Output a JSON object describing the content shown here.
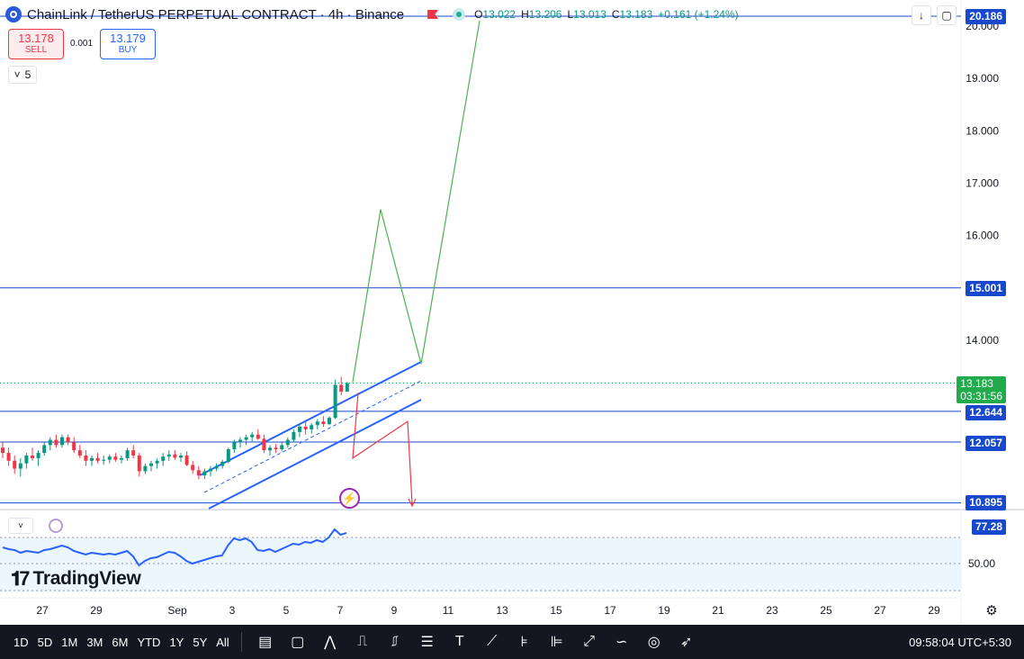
{
  "header": {
    "symbol": "ChainLink / TetherUS PERPETUAL CONTRACT · 4h · Binance",
    "ohlc": [
      {
        "k": "O",
        "v": "13.022"
      },
      {
        "k": "H",
        "v": "13.206"
      },
      {
        "k": "L",
        "v": "13.013"
      },
      {
        "k": "C",
        "v": "13.183"
      },
      {
        "k": "",
        "v": "+0.161 (+1.24%)"
      }
    ]
  },
  "trade": {
    "sell_price": "13.178",
    "sell_label": "SELL",
    "spread": "0.001",
    "buy_price": "13.179",
    "buy_label": "BUY"
  },
  "legend_toggle_count": "5",
  "price_labels": {
    "top": "20.186",
    "line1": "15.001",
    "current": "13.183",
    "countdown": "03:31:56",
    "line2": "12.644",
    "line3": "12.057",
    "line4": "10.895"
  },
  "price_axis_ticks": [
    "20.000",
    "19.000",
    "18.000",
    "17.000",
    "16.000",
    "14.000"
  ],
  "indicator": {
    "value_label": "77.28",
    "tick_label": "50.00"
  },
  "time_axis_ticks": [
    "27",
    "29",
    "Sep",
    "3",
    "5",
    "7",
    "9",
    "11",
    "13",
    "15",
    "17",
    "19",
    "21",
    "23",
    "25",
    "27",
    "29"
  ],
  "brand": "TradingView",
  "bottom_bar": {
    "timeframes": [
      "1D",
      "5D",
      "1M",
      "3M",
      "6M",
      "YTD",
      "1Y",
      "5Y",
      "All"
    ],
    "clock": "09:58:04 UTC+5:30",
    "tool_icons": [
      "calendar-range-icon",
      "rectangle-icon",
      "path-icon",
      "long-position-icon",
      "short-position-icon",
      "parallel-channel-icon",
      "text-icon",
      "trend-line-icon",
      "fib-retracement-icon",
      "volume-profile-icon",
      "measure-icon",
      "curve-icon",
      "circle-target-icon",
      "arrow-icon"
    ]
  },
  "colors": {
    "level_line": "#1848cc",
    "channel": "#2962ff",
    "bull_path": "#4caf50",
    "bear_path": "#f23645",
    "candle_up": "#089981",
    "candle_down": "#f23645",
    "indicator_line": "#2962ff"
  },
  "chart_data": {
    "type": "candlestick",
    "candles": [
      {
        "o": 11.95,
        "h": 12.05,
        "l": 11.75,
        "c": 11.85
      },
      {
        "o": 11.85,
        "h": 11.95,
        "l": 11.6,
        "c": 11.7
      },
      {
        "o": 11.7,
        "h": 11.8,
        "l": 11.45,
        "c": 11.55
      },
      {
        "o": 11.55,
        "h": 11.75,
        "l": 11.4,
        "c": 11.65
      },
      {
        "o": 11.65,
        "h": 11.85,
        "l": 11.55,
        "c": 11.8
      },
      {
        "o": 11.8,
        "h": 11.95,
        "l": 11.7,
        "c": 11.75
      },
      {
        "o": 11.75,
        "h": 11.9,
        "l": 11.6,
        "c": 11.85
      },
      {
        "o": 11.85,
        "h": 12.05,
        "l": 11.8,
        "c": 12.0
      },
      {
        "o": 12.0,
        "h": 12.15,
        "l": 11.9,
        "c": 12.1
      },
      {
        "o": 12.1,
        "h": 12.2,
        "l": 11.95,
        "c": 12.0
      },
      {
        "o": 12.0,
        "h": 12.2,
        "l": 11.95,
        "c": 12.15
      },
      {
        "o": 12.15,
        "h": 12.2,
        "l": 12.0,
        "c": 12.05
      },
      {
        "o": 12.05,
        "h": 12.15,
        "l": 11.85,
        "c": 11.9
      },
      {
        "o": 11.9,
        "h": 12.0,
        "l": 11.75,
        "c": 11.8
      },
      {
        "o": 11.8,
        "h": 11.9,
        "l": 11.6,
        "c": 11.7
      },
      {
        "o": 11.7,
        "h": 11.8,
        "l": 11.6,
        "c": 11.75
      },
      {
        "o": 11.75,
        "h": 11.85,
        "l": 11.65,
        "c": 11.7
      },
      {
        "o": 11.7,
        "h": 11.8,
        "l": 11.62,
        "c": 11.72
      },
      {
        "o": 11.72,
        "h": 11.82,
        "l": 11.65,
        "c": 11.78
      },
      {
        "o": 11.78,
        "h": 11.85,
        "l": 11.68,
        "c": 11.72
      },
      {
        "o": 11.72,
        "h": 11.8,
        "l": 11.65,
        "c": 11.75
      },
      {
        "o": 11.75,
        "h": 11.95,
        "l": 11.7,
        "c": 11.9
      },
      {
        "o": 11.9,
        "h": 12.0,
        "l": 11.75,
        "c": 11.8
      },
      {
        "o": 11.8,
        "h": 11.85,
        "l": 11.4,
        "c": 11.5
      },
      {
        "o": 11.5,
        "h": 11.65,
        "l": 11.45,
        "c": 11.6
      },
      {
        "o": 11.6,
        "h": 11.7,
        "l": 11.5,
        "c": 11.65
      },
      {
        "o": 11.65,
        "h": 11.75,
        "l": 11.55,
        "c": 11.7
      },
      {
        "o": 11.7,
        "h": 11.85,
        "l": 11.6,
        "c": 11.78
      },
      {
        "o": 11.78,
        "h": 11.9,
        "l": 11.7,
        "c": 11.82
      },
      {
        "o": 11.82,
        "h": 11.9,
        "l": 11.72,
        "c": 11.76
      },
      {
        "o": 11.76,
        "h": 11.85,
        "l": 11.68,
        "c": 11.8
      },
      {
        "o": 11.8,
        "h": 11.88,
        "l": 11.6,
        "c": 11.62
      },
      {
        "o": 11.62,
        "h": 11.7,
        "l": 11.45,
        "c": 11.52
      },
      {
        "o": 11.52,
        "h": 11.6,
        "l": 11.35,
        "c": 11.42
      },
      {
        "o": 11.42,
        "h": 11.55,
        "l": 11.35,
        "c": 11.5
      },
      {
        "o": 11.5,
        "h": 11.6,
        "l": 11.4,
        "c": 11.55
      },
      {
        "o": 11.55,
        "h": 11.65,
        "l": 11.5,
        "c": 11.6
      },
      {
        "o": 11.6,
        "h": 11.72,
        "l": 11.55,
        "c": 11.68
      },
      {
        "o": 11.68,
        "h": 11.95,
        "l": 11.65,
        "c": 11.92
      },
      {
        "o": 11.92,
        "h": 12.1,
        "l": 11.85,
        "c": 12.05
      },
      {
        "o": 12.05,
        "h": 12.15,
        "l": 11.95,
        "c": 12.1
      },
      {
        "o": 12.1,
        "h": 12.2,
        "l": 12.0,
        "c": 12.15
      },
      {
        "o": 12.15,
        "h": 12.25,
        "l": 12.05,
        "c": 12.2
      },
      {
        "o": 12.2,
        "h": 12.3,
        "l": 12.1,
        "c": 12.12
      },
      {
        "o": 12.12,
        "h": 12.2,
        "l": 11.85,
        "c": 11.9
      },
      {
        "o": 11.9,
        "h": 12.0,
        "l": 11.8,
        "c": 11.95
      },
      {
        "o": 11.95,
        "h": 12.02,
        "l": 11.85,
        "c": 11.92
      },
      {
        "o": 11.92,
        "h": 12.05,
        "l": 11.88,
        "c": 12.0
      },
      {
        "o": 12.0,
        "h": 12.15,
        "l": 11.95,
        "c": 12.1
      },
      {
        "o": 12.1,
        "h": 12.3,
        "l": 12.05,
        "c": 12.25
      },
      {
        "o": 12.25,
        "h": 12.4,
        "l": 12.15,
        "c": 12.35
      },
      {
        "o": 12.35,
        "h": 12.45,
        "l": 12.2,
        "c": 12.3
      },
      {
        "o": 12.3,
        "h": 12.42,
        "l": 12.22,
        "c": 12.38
      },
      {
        "o": 12.38,
        "h": 12.5,
        "l": 12.3,
        "c": 12.45
      },
      {
        "o": 12.45,
        "h": 12.55,
        "l": 12.35,
        "c": 12.4
      },
      {
        "o": 12.4,
        "h": 12.55,
        "l": 12.38,
        "c": 12.52
      },
      {
        "o": 12.52,
        "h": 13.25,
        "l": 12.5,
        "c": 13.15
      },
      {
        "o": 13.15,
        "h": 13.3,
        "l": 12.95,
        "c": 13.02
      },
      {
        "o": 13.022,
        "h": 13.206,
        "l": 13.013,
        "c": 13.183
      }
    ],
    "levels": [
      20.186,
      15.001,
      12.644,
      12.057,
      10.895
    ],
    "bull_projection": [
      {
        "date": "Sep 7",
        "price": 13.2
      },
      {
        "date": "Sep 8",
        "price": 16.5
      },
      {
        "date": "Sep 10",
        "price": 13.55
      },
      {
        "date": "Sep 12",
        "price": 20.1
      }
    ],
    "bear_projection": [
      {
        "date": "Sep 7",
        "price": 13.0
      },
      {
        "date": "Sep 7",
        "price": 11.75
      },
      {
        "date": "Sep 9",
        "price": 12.45
      },
      {
        "date": "Sep 9",
        "price": 10.9
      }
    ],
    "indicator_values": [
      68,
      66,
      65,
      62,
      64,
      63,
      62,
      65,
      66,
      68,
      70,
      68,
      64,
      62,
      60,
      62,
      61,
      60,
      61,
      60,
      62,
      64,
      58,
      48,
      53,
      56,
      57,
      60,
      63,
      62,
      58,
      53,
      50,
      52,
      54,
      56,
      58,
      59,
      70,
      78,
      76,
      78,
      74,
      65,
      64,
      66,
      63,
      66,
      69,
      72,
      71,
      74,
      73,
      76,
      74,
      79,
      88,
      82,
      84
    ]
  }
}
